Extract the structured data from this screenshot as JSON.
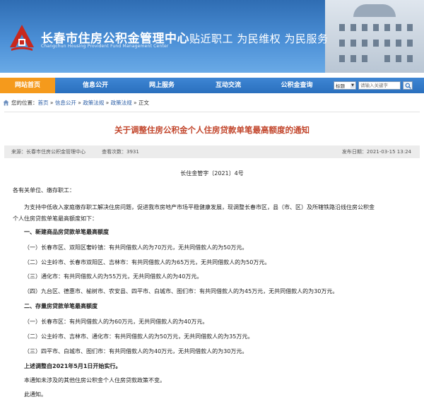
{
  "header": {
    "site_name": "长春市住房公积金管理中心",
    "site_name_en": "Changchun Housing Provident Fund Management Center",
    "slogan": "贴近职工  为民维权  为民服务"
  },
  "nav": {
    "items": [
      "网站首页",
      "信息公开",
      "网上服务",
      "互动交流",
      "公积金查询"
    ],
    "active_index": 0,
    "search_select_value": "标题",
    "search_placeholder": "请输入关键字"
  },
  "breadcrumb": {
    "prefix": "您的位置：",
    "items": [
      "首页",
      "信息公开",
      "政策法规",
      "政策法规"
    ],
    "current": "正文",
    "separator": " » "
  },
  "article": {
    "title": "关于调整住房公积金个人住房贷款单笔最高额度的通知",
    "meta": {
      "source": "来源：长春市住房公积金管理中心",
      "views_label": "查看次数：",
      "views": "3931",
      "date": "发布日期：2021-03-15 13:24"
    },
    "doc_number": "长住金管字〔2021〕4号",
    "salutation": "各有关单位、缴存职工：",
    "intro_line1": "为支持中低收入家庭缴存职工解决住房问题，促进我市房地产市场平稳健康发展，现调整长春市区，县（市、区）及所辖铁路沿线住房公积金",
    "intro_line2": "个人住房贷款单笔最高额度如下：",
    "section1_heading": "一、新建商品房贷款单笔最高额度",
    "section1_items": [
      "（一）长春市区、双阳区奢岭镇：有共同借款人的为70万元，无共同借款人的为50万元。",
      "（二）公主岭市、长春市双阳区、吉林市：有共同借款人的为65万元，无共同借款人的为50万元。",
      "（三）通化市：有共同借款人的为55万元，无共同借款人的为40万元。",
      "（四）九台区、德惠市、榆树市、农安县、四平市、白城市、图们市：有共同借款人的为45万元，无共同借款人的为30万元。"
    ],
    "section2_heading": "二、存量房贷款单笔最高额度",
    "section2_items": [
      "（一）长春市区：有共同借款人的为60万元，无共同借款人的为40万元。",
      "（二）公主岭市、吉林市、通化市：有共同借款人的为50万元，无共同借款人的为35万元。",
      "（三）四平市、白城市、图们市：有共同借款人的为40万元，无共同借款人的为30万元。"
    ],
    "effective": "上述调整自2021年5月1日开始实行。",
    "note": "本通知未涉及的其他住房公积金个人住房贷款政策不变。",
    "closing": "此通知。"
  },
  "colors": {
    "banner_blue": "#2f6db3",
    "nav_blue": "#2a6fbd",
    "nav_active": "#f59a1c",
    "title_red": "#c2462c",
    "link_blue": "#2b5ea6",
    "emblem_red": "#c8281e"
  }
}
